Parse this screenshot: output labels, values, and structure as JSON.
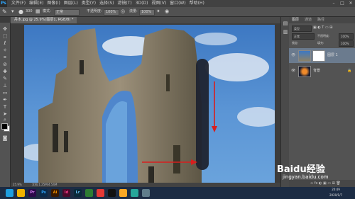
{
  "app": {
    "logo": "Ps",
    "menus": [
      "文件(F)",
      "编辑(E)",
      "图像(I)",
      "图层(L)",
      "类型(Y)",
      "选择(S)",
      "滤镜(T)",
      "3D(D)",
      "视图(V)",
      "窗口(W)",
      "帮助(H)"
    ],
    "window_controls": [
      "–",
      "□",
      "✕"
    ]
  },
  "options_bar": {
    "brush_size": "300",
    "mode_label": "模式:",
    "mode_value": "正常",
    "opacity_label": "不透明度:",
    "opacity_value": "100%",
    "flow_label": "流量:",
    "flow_value": "100%"
  },
  "document": {
    "tab_title": "丹木.jpg @ 25.9%(图层1, RGB/8) *",
    "zoom": "25.9%",
    "doc_info": "文档:1.25M/4.54M"
  },
  "panels": {
    "tabs": [
      "图层",
      "通道",
      "路径"
    ],
    "kind_filter": "类型",
    "blend_mode": "正常",
    "opacity_label": "不透明度:",
    "opacity_value": "100%",
    "lock_label": "锁定:",
    "fill_label": "填充:",
    "fill_value": "100%",
    "layers": [
      {
        "name": "图层 1"
      },
      {
        "name": "背景"
      }
    ]
  },
  "taskbar": {
    "apps": [
      {
        "label": "",
        "color": "#1e9ee0"
      },
      {
        "label": "Pr",
        "color": "#2a0a4a"
      },
      {
        "label": "Ps",
        "color": "#0a2a4a"
      },
      {
        "label": "Ai",
        "color": "#3a1a00"
      },
      {
        "label": "Id",
        "color": "#4a0a2a"
      },
      {
        "label": "Lr",
        "color": "#0a2a3a"
      },
      {
        "label": "",
        "color": "#2e7d32"
      },
      {
        "label": "",
        "color": "#e53935"
      },
      {
        "label": "",
        "color": "#111111"
      },
      {
        "label": "",
        "color": "#f9a825"
      },
      {
        "label": "",
        "color": "#26a69a"
      },
      {
        "label": "",
        "color": "#607d8b"
      }
    ],
    "clock_time": "20:49",
    "clock_date": "2020/1/7"
  },
  "watermark": {
    "brand": "Baidu经验",
    "url": "jingyan.baidu.com"
  }
}
